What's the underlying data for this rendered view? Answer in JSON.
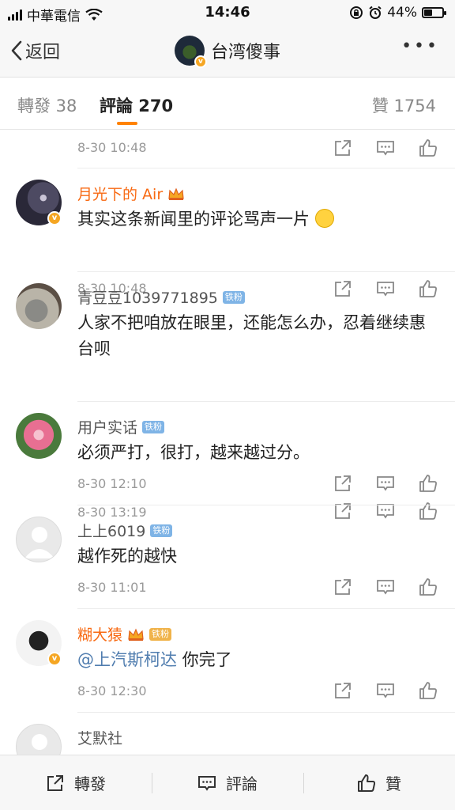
{
  "status": {
    "carrier": "中華電信",
    "time": "14:46",
    "battery": "44%",
    "battery_level": 0.44
  },
  "nav": {
    "back_label": "返回",
    "title": "台湾傻事"
  },
  "tabs": {
    "repost": "轉發 38",
    "comments": "評論 270",
    "likes": "贊 1754"
  },
  "comments": [
    {
      "time": "8-30 10:48"
    },
    {
      "name": "月光下的 Air",
      "text": "其实这条新闻里的评论骂声一片",
      "time": "8-30 10:48"
    },
    {
      "name": "青豆豆1039771895",
      "badge": "铁粉",
      "text": "人家不把咱放在眼里，还能怎么办，忍着继续惠台呗",
      "time": "8-30 13:19"
    },
    {
      "name": "用户实话",
      "badge": "铁粉",
      "text": "必须严打，很打，越来越过分。",
      "time": "8-30 12:10"
    },
    {
      "name": "上上6019",
      "badge": "铁粉",
      "text": "越作死的越快",
      "time": "8-30 11:01"
    },
    {
      "name": "糊大猿",
      "badge": "铁粉",
      "mention": "@上汽斯柯达",
      "text": " 你完了",
      "time": "8-30 12:30"
    },
    {
      "name": "艾默社"
    }
  ],
  "bottom": {
    "repost": "轉發",
    "comment": "評論",
    "like": "贊"
  },
  "colors": {
    "accent_orange": "#ff8200",
    "vip_name": "#f86a13",
    "mention": "#507daf",
    "fan_badge": "#7fb4e6"
  }
}
